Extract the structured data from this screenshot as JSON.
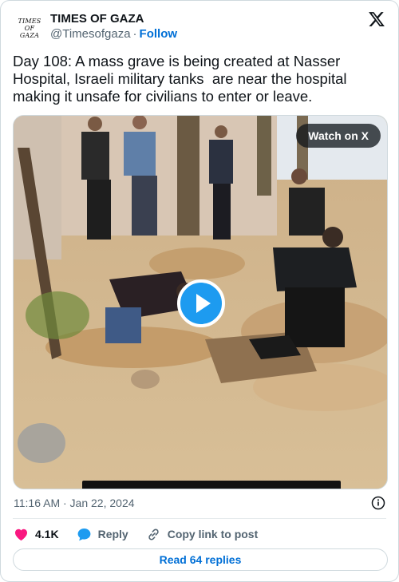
{
  "account": {
    "avatar_lines": [
      "TIMES",
      "OF",
      "GAZA"
    ],
    "display_name": "TIMES OF GAZA",
    "handle": "@Timesofgaza",
    "separator": "·",
    "follow_label": "Follow"
  },
  "tweet": {
    "text": "Day 108: A mass grave is being created at Nasser Hospital, Israeli military tanks  are near the hospital making it unsafe for civilians to enter or leave."
  },
  "media": {
    "watch_label": "Watch on X",
    "play_icon": "play-icon"
  },
  "meta": {
    "timestamp": "11:16 AM · Jan 22, 2024"
  },
  "actions": {
    "likes": "4.1K",
    "reply_label": "Reply",
    "copy_label": "Copy link to post"
  },
  "footer": {
    "read_replies_label": "Read 64 replies"
  },
  "colors": {
    "like_heart": "#f91880",
    "reply_bubble": "#1d9bf0",
    "link_blue": "#006fd6",
    "play_button": "#1d9bf0"
  }
}
